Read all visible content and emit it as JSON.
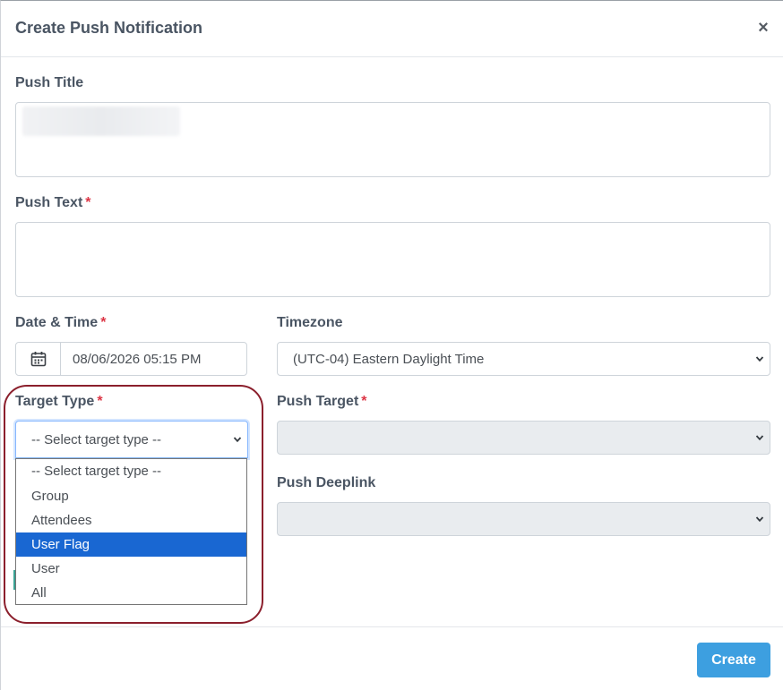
{
  "modal": {
    "title": "Create Push Notification",
    "close_symbol": "×"
  },
  "form": {
    "push_title": {
      "label": "Push Title",
      "value": ""
    },
    "push_text": {
      "label": "Push Text",
      "required_mark": "*",
      "value": ""
    },
    "date_time": {
      "label": "Date & Time",
      "required_mark": "*",
      "value": "08/06/2026 05:15 PM",
      "icon": "calendar-icon"
    },
    "timezone": {
      "label": "Timezone",
      "value": "(UTC-04) Eastern Daylight Time"
    },
    "target_type": {
      "label": "Target Type",
      "required_mark": "*",
      "value": "-- Select target type --",
      "options": [
        "-- Select target type --",
        "Group",
        "Attendees",
        "User Flag",
        "User",
        "All"
      ],
      "highlighted_option": "User Flag"
    },
    "push_target": {
      "label": "Push Target",
      "required_mark": "*",
      "value": ""
    },
    "push_deeplink": {
      "label": "Push Deeplink",
      "value": ""
    }
  },
  "footer": {
    "create_label": "Create"
  },
  "colors": {
    "accent": "#3d9fe0",
    "required": "#dc3545",
    "highlight_ring": "#8b1f2c",
    "option_selected": "#1967d2"
  }
}
